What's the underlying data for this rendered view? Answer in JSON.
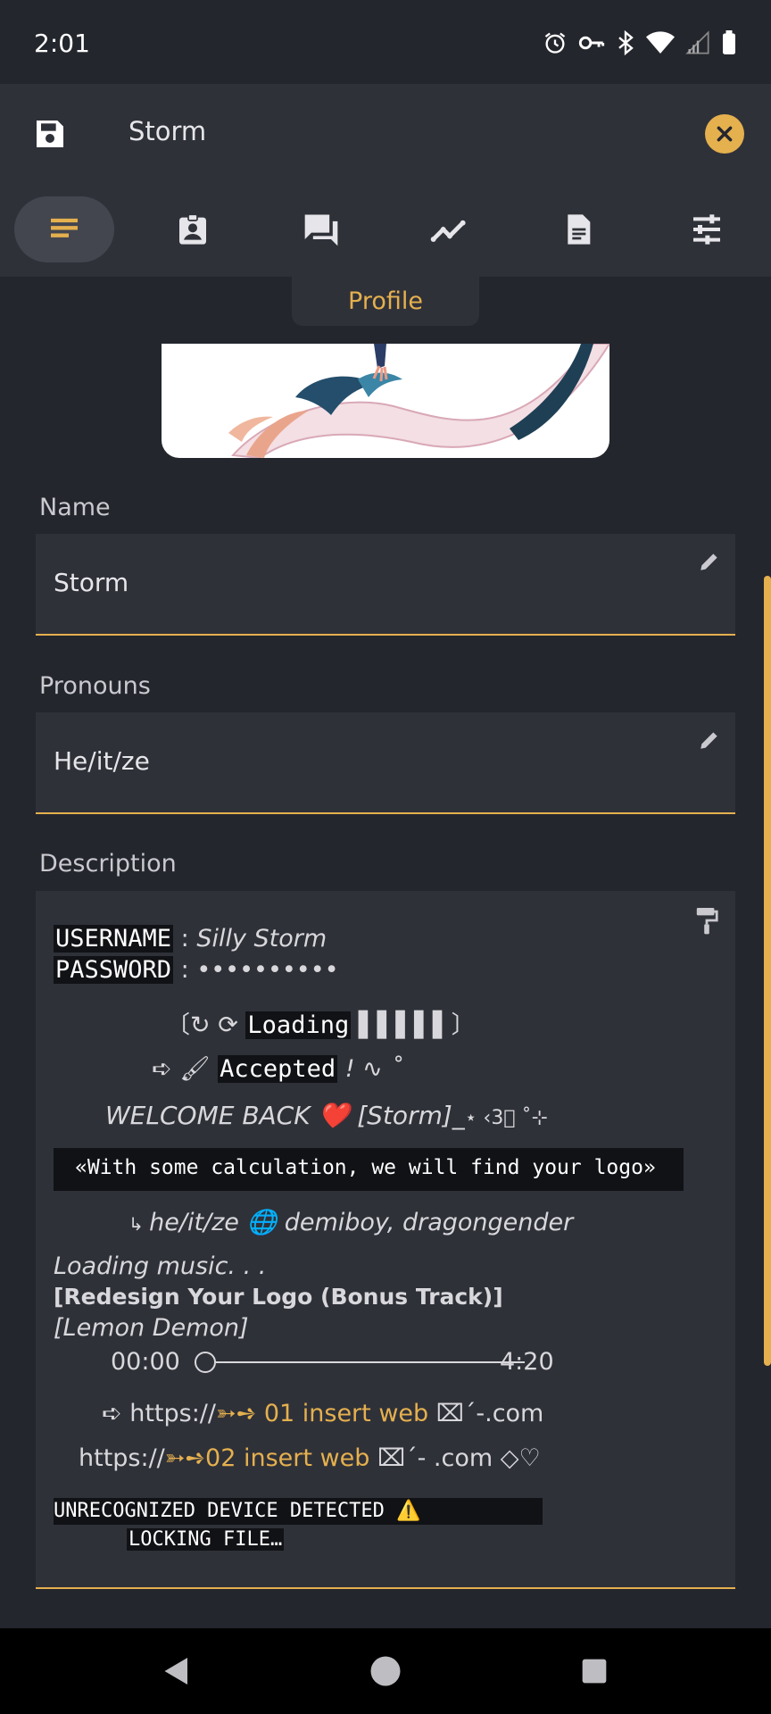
{
  "status_bar": {
    "time": "2:01"
  },
  "app_bar": {
    "title": "Storm"
  },
  "tabs": [
    {
      "icon": "notes-icon",
      "active": true
    },
    {
      "icon": "badge-icon",
      "active": false
    },
    {
      "icon": "chat-icon",
      "active": false
    },
    {
      "icon": "trend-icon",
      "active": false
    },
    {
      "icon": "document-icon",
      "active": false
    },
    {
      "icon": "tune-icon",
      "active": false
    }
  ],
  "active_tab_label": "Profile",
  "fields": {
    "name_label": "Name",
    "name_value": "Storm",
    "pronouns_label": "Pronouns",
    "pronouns_value": "He/it/ze",
    "description_label": "Description"
  },
  "description": {
    "username_key": "USERNAME",
    "username_sep": " : ",
    "username_value": "Silly Storm",
    "password_key": "PASSWORD",
    "password_sep": " : ",
    "password_value": "••••••••••",
    "loading_prefix": "〔↻ ⟳ ",
    "loading_word": "Loading",
    "loading_suffix": " ▌▌▌▌▌〕",
    "accepted_prefix": "➪ 🖌 ",
    "accepted_word": "Accepted",
    "accepted_suffix": " ! ∿ ˚",
    "welcome": "WELCOME BACK ❤️ [Storm]_",
    "welcome_suffix": "⋆ ‹3⃝ ˚⊹",
    "calc_line": "«With some calculation, we will find your logo»",
    "pronoun_prefix": "↳ ",
    "pronoun_line": "he/it/ze 🌐 demiboy, dragongender",
    "loading_music": "Loading music. . .",
    "track_title": "[Redesign Your Logo (Bonus Track)]",
    "track_artist": "[Lemon Demon]",
    "time_start": "00:00",
    "time_end": "4:20",
    "link1_prefix": "➪  https://",
    "link1_gold": "➳➺ 01 insert web",
    "link1_suffix": " ⌧ˊ-.com",
    "link2_prefix": "https://",
    "link2_gold": "➳➺02  insert web",
    "link2_suffix": " ⌧ˊ- .com ◇♡",
    "warning_line1": "UNRECOGNIZED DEVICE DETECTED    ⚠️",
    "warning_line2": "LOCKING FILE…"
  },
  "colors": {
    "background": "#24262d",
    "surface": "#2f3139",
    "accent": "#e5b04e"
  }
}
